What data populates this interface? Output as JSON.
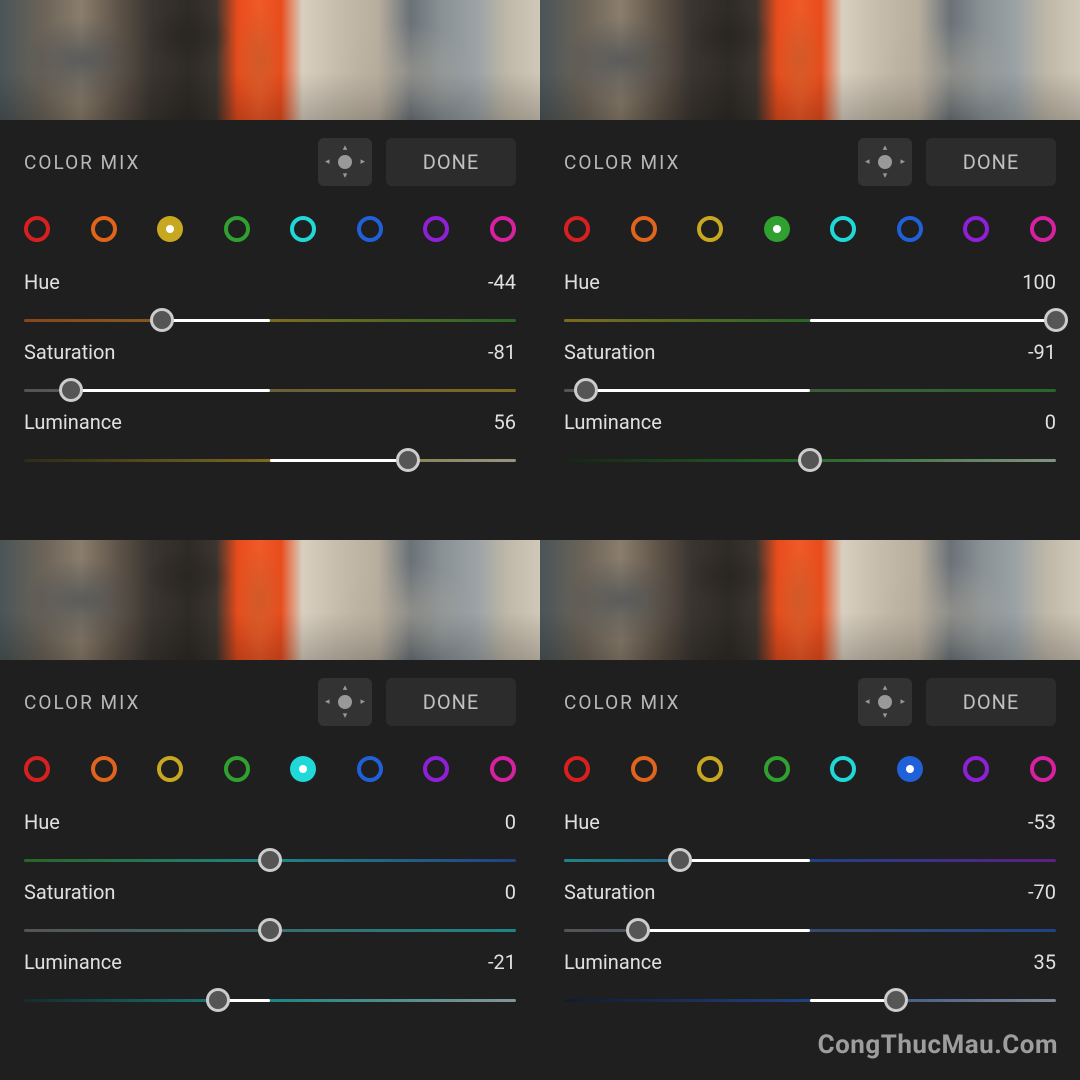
{
  "watermark": "CongThucMau.Com",
  "colors": [
    {
      "name": "red",
      "value": "#d82020"
    },
    {
      "name": "orange",
      "value": "#e0641c"
    },
    {
      "name": "yellow",
      "value": "#c8a820"
    },
    {
      "name": "green",
      "value": "#30a030"
    },
    {
      "name": "aqua",
      "value": "#20d8d8"
    },
    {
      "name": "blue",
      "value": "#2060d8"
    },
    {
      "name": "purple",
      "value": "#9020d8"
    },
    {
      "name": "magenta",
      "value": "#d820a0"
    }
  ],
  "panels": [
    {
      "title": "COLOR MIX",
      "done_label": "DONE",
      "selected_color": "yellow",
      "hue": {
        "label": "Hue",
        "value": -44,
        "gradient": [
          "#e0641c",
          "#c8a820",
          "#30a030"
        ]
      },
      "saturation": {
        "label": "Saturation",
        "value": -81,
        "gradient": [
          "#808080",
          "#c8a820"
        ]
      },
      "luminance": {
        "label": "Luminance",
        "value": 56,
        "gradient": [
          "#3a3410",
          "#c8a820",
          "#faf4d0"
        ]
      }
    },
    {
      "title": "COLOR MIX",
      "done_label": "DONE",
      "selected_color": "green",
      "hue": {
        "label": "Hue",
        "value": 100,
        "gradient": [
          "#c8a820",
          "#30a030",
          "#20d8d8"
        ]
      },
      "saturation": {
        "label": "Saturation",
        "value": -91,
        "gradient": [
          "#808080",
          "#30a030"
        ]
      },
      "luminance": {
        "label": "Luminance",
        "value": 0,
        "gradient": [
          "#0c2c0c",
          "#30a030",
          "#d0f4d0"
        ]
      }
    },
    {
      "title": "COLOR MIX",
      "done_label": "DONE",
      "selected_color": "aqua",
      "hue": {
        "label": "Hue",
        "value": 0,
        "gradient": [
          "#30a030",
          "#20d8d8",
          "#2060d8"
        ]
      },
      "saturation": {
        "label": "Saturation",
        "value": 0,
        "gradient": [
          "#808080",
          "#20d8d8"
        ]
      },
      "luminance": {
        "label": "Luminance",
        "value": -21,
        "gradient": [
          "#083838",
          "#20d8d8",
          "#d0f8f8"
        ]
      }
    },
    {
      "title": "COLOR MIX",
      "done_label": "DONE",
      "selected_color": "blue",
      "hue": {
        "label": "Hue",
        "value": -53,
        "gradient": [
          "#20d8d8",
          "#2060d8",
          "#9020d8"
        ]
      },
      "saturation": {
        "label": "Saturation",
        "value": -70,
        "gradient": [
          "#808080",
          "#2060d8"
        ]
      },
      "luminance": {
        "label": "Luminance",
        "value": 35,
        "gradient": [
          "#081838",
          "#2060d8",
          "#d0e0f8"
        ]
      }
    }
  ]
}
